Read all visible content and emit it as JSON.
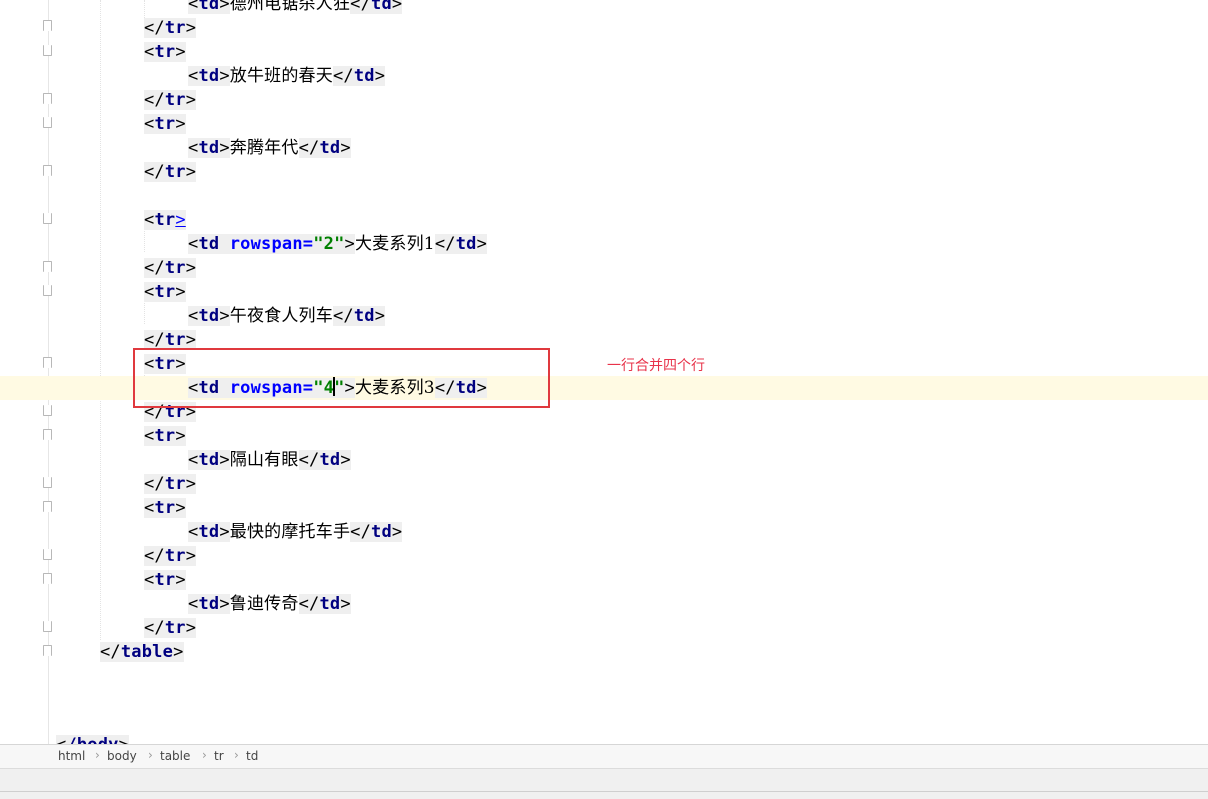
{
  "editor": {
    "lines": [
      {
        "indent": 2,
        "kind": "td",
        "text": "德州电锯杀人狂"
      },
      {
        "indent": 1,
        "kind": "close-tr"
      },
      {
        "indent": 1,
        "kind": "open-tr"
      },
      {
        "indent": 2,
        "kind": "td",
        "text": "放牛班的春天"
      },
      {
        "indent": 1,
        "kind": "close-tr"
      },
      {
        "indent": 1,
        "kind": "open-tr"
      },
      {
        "indent": 2,
        "kind": "td",
        "text": "奔腾年代"
      },
      {
        "indent": 1,
        "kind": "close-tr"
      },
      {
        "indent": 0,
        "kind": "blank"
      },
      {
        "indent": 1,
        "kind": "open-tr",
        "caret_after": true
      },
      {
        "indent": 2,
        "kind": "td-rowspan",
        "attr_name": "rowspan",
        "attr_value": "2",
        "text": "大麦系列1"
      },
      {
        "indent": 1,
        "kind": "close-tr"
      },
      {
        "indent": 1,
        "kind": "open-tr"
      },
      {
        "indent": 2,
        "kind": "td",
        "text": "午夜食人列车"
      },
      {
        "indent": 1,
        "kind": "close-tr"
      },
      {
        "indent": 1,
        "kind": "open-tr"
      },
      {
        "indent": 2,
        "kind": "td-rowspan",
        "attr_name": "rowspan",
        "attr_value": "4",
        "text": "大麦系列3",
        "current": true
      },
      {
        "indent": 1,
        "kind": "close-tr"
      },
      {
        "indent": 1,
        "kind": "open-tr"
      },
      {
        "indent": 2,
        "kind": "td",
        "text": "隔山有眼"
      },
      {
        "indent": 1,
        "kind": "close-tr"
      },
      {
        "indent": 1,
        "kind": "open-tr"
      },
      {
        "indent": 2,
        "kind": "td",
        "text": "最快的摩托车手"
      },
      {
        "indent": 1,
        "kind": "close-tr"
      },
      {
        "indent": 1,
        "kind": "open-tr"
      },
      {
        "indent": 2,
        "kind": "td",
        "text": "鲁迪传奇"
      },
      {
        "indent": 1,
        "kind": "close-tr"
      },
      {
        "indent": 0,
        "kind": "close-table"
      }
    ],
    "tag_tr": "tr",
    "tag_td": "td",
    "tag_table": "table",
    "tag_body_partial": "/body"
  },
  "annotation": {
    "text": "一行合并四个行",
    "color": "#e8334a"
  },
  "highlight_color": "#e0393e",
  "breadcrumb": [
    "html",
    "body",
    "table",
    "tr",
    "td"
  ]
}
